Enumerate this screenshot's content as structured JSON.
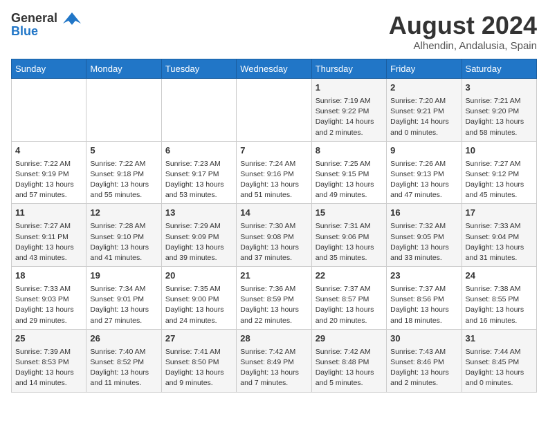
{
  "header": {
    "logo_line1": "General",
    "logo_line2": "Blue",
    "month_year": "August 2024",
    "location": "Alhendin, Andalusia, Spain"
  },
  "days_of_week": [
    "Sunday",
    "Monday",
    "Tuesday",
    "Wednesday",
    "Thursday",
    "Friday",
    "Saturday"
  ],
  "weeks": [
    [
      {
        "day": "",
        "content": ""
      },
      {
        "day": "",
        "content": ""
      },
      {
        "day": "",
        "content": ""
      },
      {
        "day": "",
        "content": ""
      },
      {
        "day": "1",
        "content": "Sunrise: 7:19 AM\nSunset: 9:22 PM\nDaylight: 14 hours\nand 2 minutes."
      },
      {
        "day": "2",
        "content": "Sunrise: 7:20 AM\nSunset: 9:21 PM\nDaylight: 14 hours\nand 0 minutes."
      },
      {
        "day": "3",
        "content": "Sunrise: 7:21 AM\nSunset: 9:20 PM\nDaylight: 13 hours\nand 58 minutes."
      }
    ],
    [
      {
        "day": "4",
        "content": "Sunrise: 7:22 AM\nSunset: 9:19 PM\nDaylight: 13 hours\nand 57 minutes."
      },
      {
        "day": "5",
        "content": "Sunrise: 7:22 AM\nSunset: 9:18 PM\nDaylight: 13 hours\nand 55 minutes."
      },
      {
        "day": "6",
        "content": "Sunrise: 7:23 AM\nSunset: 9:17 PM\nDaylight: 13 hours\nand 53 minutes."
      },
      {
        "day": "7",
        "content": "Sunrise: 7:24 AM\nSunset: 9:16 PM\nDaylight: 13 hours\nand 51 minutes."
      },
      {
        "day": "8",
        "content": "Sunrise: 7:25 AM\nSunset: 9:15 PM\nDaylight: 13 hours\nand 49 minutes."
      },
      {
        "day": "9",
        "content": "Sunrise: 7:26 AM\nSunset: 9:13 PM\nDaylight: 13 hours\nand 47 minutes."
      },
      {
        "day": "10",
        "content": "Sunrise: 7:27 AM\nSunset: 9:12 PM\nDaylight: 13 hours\nand 45 minutes."
      }
    ],
    [
      {
        "day": "11",
        "content": "Sunrise: 7:27 AM\nSunset: 9:11 PM\nDaylight: 13 hours\nand 43 minutes."
      },
      {
        "day": "12",
        "content": "Sunrise: 7:28 AM\nSunset: 9:10 PM\nDaylight: 13 hours\nand 41 minutes."
      },
      {
        "day": "13",
        "content": "Sunrise: 7:29 AM\nSunset: 9:09 PM\nDaylight: 13 hours\nand 39 minutes."
      },
      {
        "day": "14",
        "content": "Sunrise: 7:30 AM\nSunset: 9:08 PM\nDaylight: 13 hours\nand 37 minutes."
      },
      {
        "day": "15",
        "content": "Sunrise: 7:31 AM\nSunset: 9:06 PM\nDaylight: 13 hours\nand 35 minutes."
      },
      {
        "day": "16",
        "content": "Sunrise: 7:32 AM\nSunset: 9:05 PM\nDaylight: 13 hours\nand 33 minutes."
      },
      {
        "day": "17",
        "content": "Sunrise: 7:33 AM\nSunset: 9:04 PM\nDaylight: 13 hours\nand 31 minutes."
      }
    ],
    [
      {
        "day": "18",
        "content": "Sunrise: 7:33 AM\nSunset: 9:03 PM\nDaylight: 13 hours\nand 29 minutes."
      },
      {
        "day": "19",
        "content": "Sunrise: 7:34 AM\nSunset: 9:01 PM\nDaylight: 13 hours\nand 27 minutes."
      },
      {
        "day": "20",
        "content": "Sunrise: 7:35 AM\nSunset: 9:00 PM\nDaylight: 13 hours\nand 24 minutes."
      },
      {
        "day": "21",
        "content": "Sunrise: 7:36 AM\nSunset: 8:59 PM\nDaylight: 13 hours\nand 22 minutes."
      },
      {
        "day": "22",
        "content": "Sunrise: 7:37 AM\nSunset: 8:57 PM\nDaylight: 13 hours\nand 20 minutes."
      },
      {
        "day": "23",
        "content": "Sunrise: 7:37 AM\nSunset: 8:56 PM\nDaylight: 13 hours\nand 18 minutes."
      },
      {
        "day": "24",
        "content": "Sunrise: 7:38 AM\nSunset: 8:55 PM\nDaylight: 13 hours\nand 16 minutes."
      }
    ],
    [
      {
        "day": "25",
        "content": "Sunrise: 7:39 AM\nSunset: 8:53 PM\nDaylight: 13 hours\nand 14 minutes."
      },
      {
        "day": "26",
        "content": "Sunrise: 7:40 AM\nSunset: 8:52 PM\nDaylight: 13 hours\nand 11 minutes."
      },
      {
        "day": "27",
        "content": "Sunrise: 7:41 AM\nSunset: 8:50 PM\nDaylight: 13 hours\nand 9 minutes."
      },
      {
        "day": "28",
        "content": "Sunrise: 7:42 AM\nSunset: 8:49 PM\nDaylight: 13 hours\nand 7 minutes."
      },
      {
        "day": "29",
        "content": "Sunrise: 7:42 AM\nSunset: 8:48 PM\nDaylight: 13 hours\nand 5 minutes."
      },
      {
        "day": "30",
        "content": "Sunrise: 7:43 AM\nSunset: 8:46 PM\nDaylight: 13 hours\nand 2 minutes."
      },
      {
        "day": "31",
        "content": "Sunrise: 7:44 AM\nSunset: 8:45 PM\nDaylight: 13 hours\nand 0 minutes."
      }
    ]
  ]
}
